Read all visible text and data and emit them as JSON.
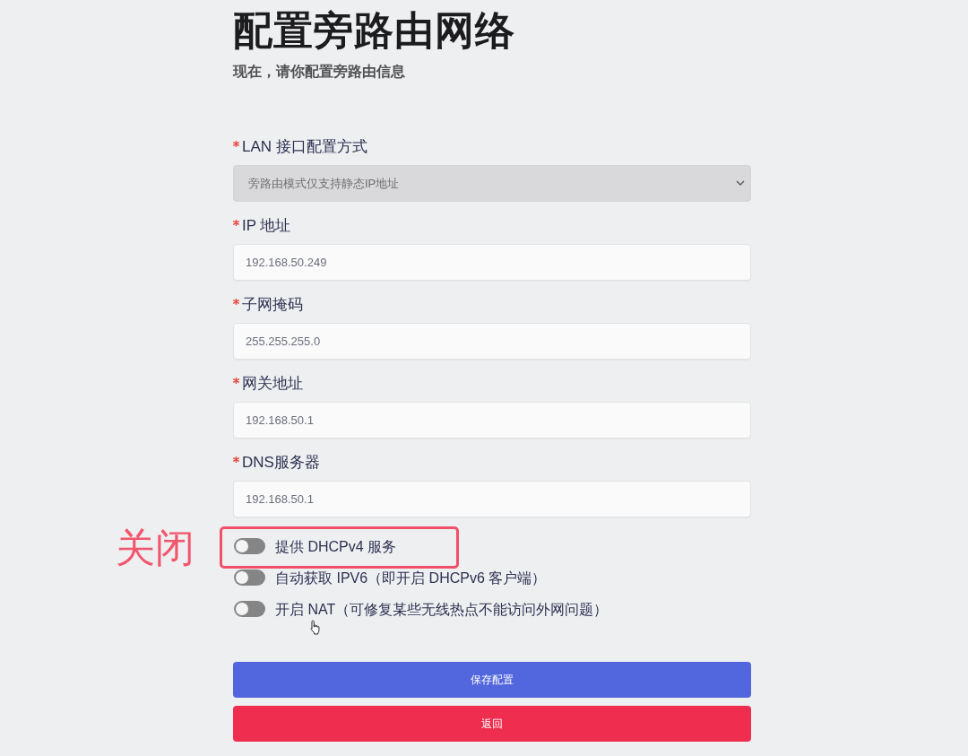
{
  "header": {
    "title": "配置旁路由网络",
    "subtitle": "现在，请你配置旁路由信息"
  },
  "fields": [
    {
      "kind": "select",
      "label": "LAN 接口配置方式",
      "required": true,
      "disabled": true,
      "value": "旁路由模式仅支持静态IP地址"
    },
    {
      "kind": "input",
      "label": "IP 地址",
      "required": true,
      "disabled": false,
      "value": "192.168.50.249"
    },
    {
      "kind": "input",
      "label": "子网掩码",
      "required": true,
      "disabled": false,
      "value": "255.255.255.0"
    },
    {
      "kind": "input",
      "label": "网关地址",
      "required": true,
      "disabled": false,
      "value": "192.168.50.1"
    },
    {
      "kind": "input",
      "label": "DNS服务器",
      "required": true,
      "disabled": false,
      "value": "192.168.50.1"
    }
  ],
  "switches": [
    {
      "label": "提供 DHCPv4 服务",
      "on": false,
      "annotation": "关闭"
    },
    {
      "label": "自动获取 IPV6（即开启 DHCPv6 客户端）",
      "on": false
    },
    {
      "label": "开启 NAT（可修复某些无线热点不能访问外网问题）",
      "on": false
    }
  ],
  "buttons": [
    {
      "kind": "primary",
      "label": "保存配置"
    },
    {
      "kind": "danger",
      "label": "返回"
    }
  ]
}
